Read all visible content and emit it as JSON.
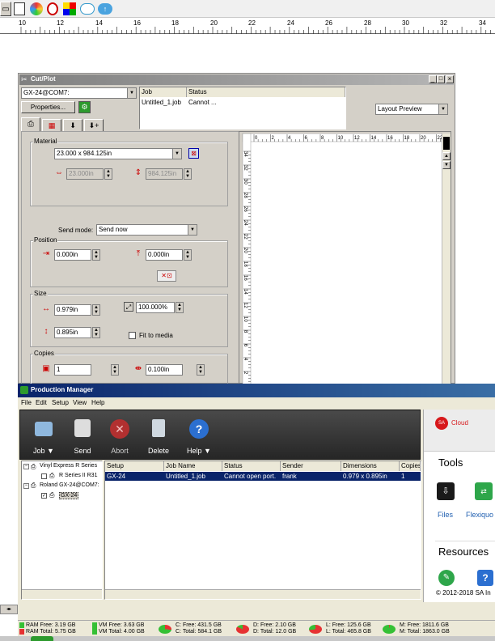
{
  "toolbar": {
    "icons": [
      "printer-icon",
      "document-icon",
      "palette-icon",
      "eyedropper-icon",
      "color-grid-icon",
      "cloud-icon",
      "cloud-upload-icon"
    ]
  },
  "top_ruler": {
    "ticks": [
      "10",
      "12",
      "14",
      "16",
      "18",
      "20",
      "22",
      "24",
      "26",
      "28",
      "30",
      "32",
      "34"
    ]
  },
  "cutplot": {
    "title": "Cut/Plot",
    "title_buttons": [
      "_",
      "□",
      "×"
    ],
    "device": "GX-24@COM7:",
    "properties_label": "Properties...",
    "job_table": {
      "headers": [
        "Job",
        "Status"
      ],
      "row": [
        "Untitled_1.job",
        "Cannot ..."
      ]
    },
    "preview_mode": "Layout Preview",
    "material": {
      "group": "Material",
      "value": "23.000 x 984.125in",
      "width": "23.000in",
      "height": "984.125in"
    },
    "send_mode": {
      "label": "Send mode:",
      "value": "Send now"
    },
    "position": {
      "group": "Position",
      "x": "0.000in",
      "y": "0.000in"
    },
    "size": {
      "group": "Size",
      "width": "0.979in",
      "scale": "100.000%",
      "height": "0.895in",
      "fit_label": "Fit to media"
    },
    "copies": {
      "group": "Copies",
      "count": "1",
      "spacing": "0.100in"
    },
    "preview_hruler": [
      "0",
      "2",
      "4",
      "6",
      "8",
      "10",
      "12",
      "14",
      "16",
      "18",
      "20",
      "22"
    ],
    "preview_vruler": [
      "34",
      "32",
      "30",
      "28",
      "26",
      "24",
      "22",
      "20",
      "18",
      "16",
      "14",
      "12",
      "10",
      "8",
      "6",
      "4",
      "2",
      "0"
    ]
  },
  "pm": {
    "title": "Production Manager",
    "menu": [
      "File",
      "Edit",
      "Setup",
      "View",
      "Help"
    ],
    "toolbar": [
      {
        "label": "Job ▼",
        "icon": "folder-icon"
      },
      {
        "label": "Send",
        "icon": "printer-icon"
      },
      {
        "label": "Abort",
        "icon": "abort-icon"
      },
      {
        "label": "Delete",
        "icon": "trash-icon"
      },
      {
        "label": "Help ▼",
        "icon": "help-icon"
      }
    ],
    "tree": {
      "group1": "Vinyl Express R Series",
      "item1": "R Series II R31",
      "group2": "Roland GX-24@COM7:",
      "item2": "GX-24"
    },
    "table": {
      "headers": [
        "Setup",
        "Job Name",
        "Status",
        "Sender",
        "Dimensions",
        "Copies"
      ],
      "row": [
        "GX-24",
        "Untitled_1.job",
        "Cannot open port.",
        "frank",
        "0.979 x 0.895in",
        "1"
      ]
    },
    "side": {
      "cloud": "Cloud",
      "tools_heading": "Tools",
      "tool1": "Files",
      "tool2": "Flexiquo",
      "resources_heading": "Resources",
      "copyright": "© 2012-2018 SA In"
    }
  },
  "status": {
    "ram_free": "RAM Free: 3.19 GB",
    "ram_total": "RAM Total: 5.75 GB",
    "vm_free": "VM Free: 3.63 GB",
    "vm_total": "VM Total: 4.00 GB",
    "c_free": "C: Free: 431.5 GB",
    "c_total": "C: Total: 584.1 GB",
    "d_free": "D: Free: 2.10 GB",
    "d_total": "D: Total: 12.0 GB",
    "l_free": "L: Free: 125.6 GB",
    "l_total": "L: Total: 465.8 GB",
    "m_free": "M: Free: 1811.6 GB",
    "m_total": "M: Total: 1863.0 GB"
  },
  "colors": {
    "xp_title_dark": "#0a246a",
    "classic_title": "#808080",
    "pm_toolbar": "#3a3a3a",
    "selection": "#0a246a",
    "dialog_face": "#d4d0c8",
    "sa_red": "#d7191c"
  }
}
